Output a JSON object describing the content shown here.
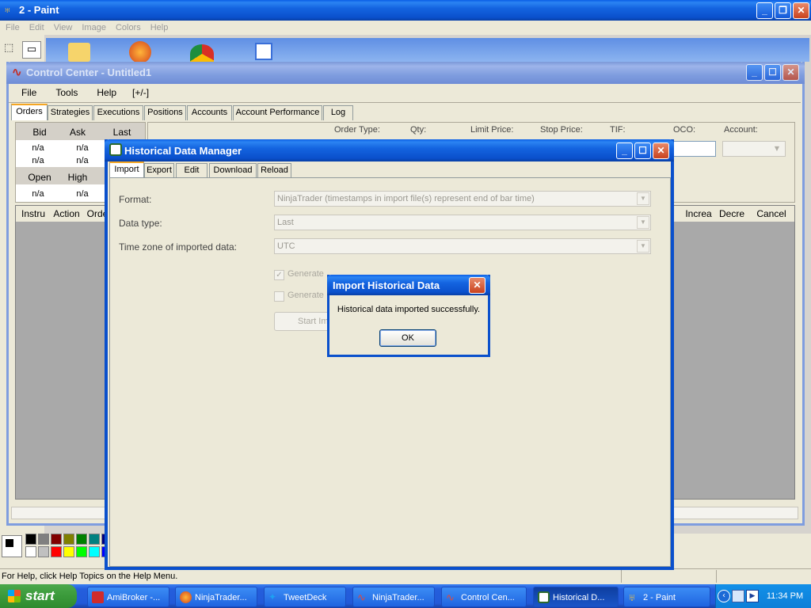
{
  "paint": {
    "title": "2 - Paint",
    "menu": [
      "File",
      "Edit",
      "View",
      "Image",
      "Colors",
      "Help"
    ],
    "status": "For Help, click Help Topics on the Help Menu."
  },
  "control_center": {
    "title": "Control Center - Untitled1",
    "menu": [
      "File",
      "Tools",
      "Help",
      "[+/-]"
    ],
    "tabs": [
      "Orders",
      "Strategies",
      "Executions",
      "Positions",
      "Accounts",
      "Account Performance",
      "Log"
    ],
    "quote_headers": [
      "Bid",
      "Ask",
      "Last"
    ],
    "quote_values_row1": [
      "n/a",
      "n/a"
    ],
    "quote_values_row2": [
      "n/a",
      "n/a"
    ],
    "ohl_headers": [
      "Open",
      "High"
    ],
    "ohl_values": [
      "n/a",
      "n/a"
    ],
    "order_labels": [
      "Order Type:",
      "Qty:",
      "Limit Price:",
      "Stop Price:",
      "TIF:",
      "OCO:",
      "Account:"
    ],
    "grid_headers_left": [
      "Instru",
      "Action",
      "Orde"
    ],
    "grid_headers_right": [
      "Increa",
      "Decre",
      "Cancel"
    ]
  },
  "hdm": {
    "title": "Historical Data Manager",
    "tabs": [
      "Import",
      "Export",
      "Edit",
      "Download",
      "Reload"
    ],
    "format_label": "Format:",
    "format_value": "NinjaTrader (timestamps in import file(s) represent end of bar time)",
    "datatype_label": "Data type:",
    "datatype_value": "Last",
    "timezone_label": "Time zone of imported data:",
    "timezone_value": "UTC",
    "generate1": "Generate",
    "generate2": "Generate",
    "start_button": "Start Im"
  },
  "dialog": {
    "title": "Import Historical Data",
    "message": "Historical data imported successfully.",
    "ok": "OK"
  },
  "taskbar": {
    "start": "start",
    "items": [
      "AmiBroker -...",
      "NinjaTrader...",
      "TweetDeck",
      "NinjaTrader...",
      "Control Cen...",
      "Historical D...",
      "2 - Paint"
    ],
    "time": "11:34 PM"
  },
  "colors": {
    "palette_row1": [
      "#000000",
      "#808080",
      "#800000",
      "#808000",
      "#008000",
      "#008080",
      "#000080"
    ],
    "palette_row2": [
      "#ffffff",
      "#c0c0c0",
      "#ff0000",
      "#ffff00",
      "#00ff00",
      "#00ffff",
      "#0000ff"
    ]
  }
}
